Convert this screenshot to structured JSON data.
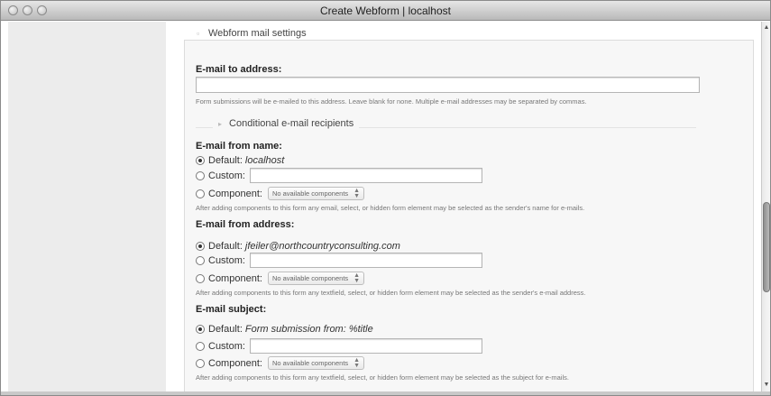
{
  "window": {
    "title": "Create Webform | localhost"
  },
  "fieldset": {
    "legend": "Webform mail settings",
    "email_to": {
      "label": "E-mail to address:",
      "value": "",
      "description": "Form submissions will be e-mailed to this address. Leave blank for none. Multiple e-mail addresses may be separated by commas."
    },
    "conditional": {
      "legend": "Conditional e-mail recipients"
    },
    "from_name": {
      "label": "E-mail from name:",
      "default_label": "Default:",
      "default_value": "localhost",
      "custom_label": "Custom:",
      "custom_value": "",
      "component_label": "Component:",
      "component_select": "No available components",
      "description": "After adding components to this form any email, select, or hidden form element may be selected as the sender's name for e-mails.",
      "selected": "default"
    },
    "from_address": {
      "label": "E-mail from address:",
      "default_label": "Default:",
      "default_value": "jfeiler@northcountryconsulting.com",
      "custom_label": "Custom:",
      "custom_value": "",
      "component_label": "Component:",
      "component_select": "No available components",
      "description": "After adding components to this form any textfield, select, or hidden form element may be selected as the sender's e-mail address.",
      "selected": "default"
    },
    "subject": {
      "label": "E-mail subject:",
      "default_label": "Default:",
      "default_value": "Form submission from: %title",
      "custom_label": "Custom:",
      "custom_value": "",
      "component_label": "Component:",
      "component_select": "No available components",
      "description": "After adding components to this form any textfield, select, or hidden form element may be selected as the subject for e-mails.",
      "selected": "default"
    }
  },
  "icons": {
    "scroll_up": "scroll-up-arrow-icon",
    "scroll_down": "scroll-down-arrow-icon",
    "collapse": "triangle-icon"
  }
}
